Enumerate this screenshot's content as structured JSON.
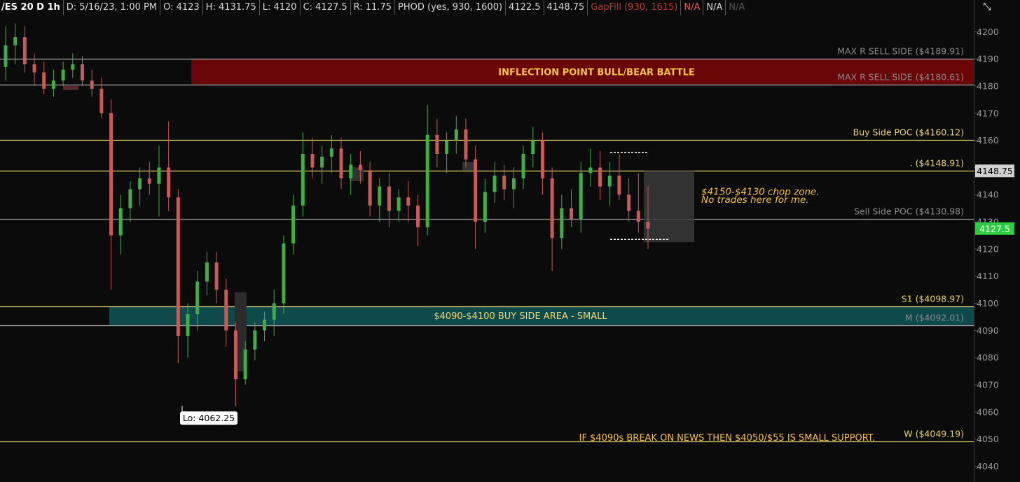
{
  "header": {
    "symbol": "/ES 20 D 1h",
    "date": "D: 5/16/23, 1:00 PM",
    "open": "O: 4123",
    "high": "H: 4131.75",
    "low": "L: 4120",
    "close": "C: 4127.5",
    "range": "R: 11.75",
    "phod": "PHOD (yes, 930, 1600)",
    "val1": "4122.5",
    "val2": "4148.75",
    "gapfill": "GapFill (930, 1615)",
    "na1": "N/A",
    "na2": "N/A",
    "na3": "N/A"
  },
  "chart_data": {
    "type": "candlestick",
    "ylim": [
      4036,
      4206
    ],
    "y_ticks": [
      4040,
      4050,
      4060,
      4070,
      4080,
      4090,
      4100,
      4110,
      4120,
      4130,
      4140,
      4150,
      4160,
      4170,
      4180,
      4190,
      4200
    ],
    "price_tags": [
      {
        "label": "4148.75",
        "value": 4148.75,
        "color": "#d0d0d0",
        "text_color": "#000000"
      },
      {
        "label": "4127.5",
        "value": 4127.5,
        "color": "#2ecc40",
        "text_color": "#ffffff"
      }
    ],
    "levels": [
      {
        "label": "MAX R SELL SIDE  ($4189.91)",
        "value": 4189.91,
        "color": "#aaaaaa",
        "text_color": "#8a8a8a"
      },
      {
        "label": "MAX R SELL SIDE  ($4180.61)",
        "value": 4180.61,
        "color": "#aaaaaa",
        "text_color": "#8a8a8a"
      },
      {
        "label": "Buy Side POC  ($4160.12)",
        "value": 4160.12,
        "color": "#e8d36a",
        "text_color": "#e8d36a"
      },
      {
        "label": ". ($4148.91)",
        "value": 4148.91,
        "color": "#e8d36a",
        "text_color": "#e8d36a"
      },
      {
        "label": "Sell Side POC ($4130.98)",
        "value": 4130.98,
        "color": "#8a8a8a",
        "text_color": "#8a8a8a"
      },
      {
        "label": "S1 ($4098.97)",
        "value": 4098.97,
        "color": "#e8d36a",
        "text_color": "#e8d36a"
      },
      {
        "label": "M ($4092.01)",
        "value": 4092.01,
        "color": "#aaaaaa",
        "text_color": "#8a8a8a"
      },
      {
        "label": "W ($4049.19)",
        "value": 4049.19,
        "color": "#e8d36a",
        "text_color": "#e8d36a"
      }
    ],
    "zones": [
      {
        "label": "INFLECTION POINT BULL/BEAR BATTLE",
        "from": 4180.61,
        "to": 4189.91,
        "color": "#6a0606",
        "text_color": "#f5c242"
      },
      {
        "label": "$4090-$4100 BUY SIDE AREA - SMALL",
        "from": 4092.01,
        "to": 4098.97,
        "color": "#0e4a4c",
        "text_color": "#f5d76e"
      }
    ],
    "annotations": [
      {
        "text": "$4150-$4130 chop zone.",
        "value": 4141
      },
      {
        "text": "No trades here for me.",
        "value": 4138
      },
      {
        "text": "IF $4090s BREAK ON NEWS THEN $4050/$55 IS SMALL SUPPORT.",
        "value": 4051
      }
    ],
    "low_label": {
      "text": "Lo: 4062.25",
      "value": 4062.25
    },
    "candles": [
      [
        4187,
        4202,
        4182,
        4195
      ],
      [
        4195,
        4203,
        4188,
        4198
      ],
      [
        4198,
        4202,
        4185,
        4188
      ],
      [
        4188,
        4192,
        4180,
        4185
      ],
      [
        4185,
        4189,
        4177,
        4179
      ],
      [
        4179,
        4186,
        4176,
        4182
      ],
      [
        4182,
        4189,
        4180,
        4186
      ],
      [
        4186,
        4192,
        4183,
        4188
      ],
      [
        4188,
        4191,
        4180,
        4182
      ],
      [
        4182,
        4186,
        4176,
        4179
      ],
      [
        4179,
        4183,
        4168,
        4170
      ],
      [
        4170,
        4175,
        4105,
        4125
      ],
      [
        4125,
        4140,
        4118,
        4135
      ],
      [
        4135,
        4145,
        4130,
        4142
      ],
      [
        4142,
        4150,
        4136,
        4146
      ],
      [
        4146,
        4152,
        4140,
        4144
      ],
      [
        4144,
        4158,
        4132,
        4150
      ],
      [
        4150,
        4167,
        4134,
        4139
      ],
      [
        4139,
        4142,
        4078,
        4088
      ],
      [
        4088,
        4100,
        4080,
        4096
      ],
      [
        4096,
        4112,
        4090,
        4108
      ],
      [
        4108,
        4119,
        4103,
        4115
      ],
      [
        4115,
        4119,
        4100,
        4105
      ],
      [
        4105,
        4109,
        4084,
        4090
      ],
      [
        4090,
        4093,
        4062,
        4072
      ],
      [
        4072,
        4086,
        4070,
        4083
      ],
      [
        4083,
        4093,
        4079,
        4090
      ],
      [
        4090,
        4097,
        4086,
        4094
      ],
      [
        4094,
        4105,
        4088,
        4100
      ],
      [
        4100,
        4125,
        4096,
        4122
      ],
      [
        4122,
        4140,
        4118,
        4136
      ],
      [
        4136,
        4163,
        4132,
        4155
      ],
      [
        4155,
        4161,
        4146,
        4150
      ],
      [
        4150,
        4158,
        4144,
        4154
      ],
      [
        4154,
        4162,
        4148,
        4157
      ],
      [
        4157,
        4161,
        4142,
        4146
      ],
      [
        4146,
        4155,
        4140,
        4151
      ],
      [
        4151,
        4156,
        4144,
        4149
      ],
      [
        4149,
        4152,
        4132,
        4136
      ],
      [
        4136,
        4146,
        4130,
        4143
      ],
      [
        4143,
        4148,
        4128,
        4134
      ],
      [
        4134,
        4142,
        4130,
        4139
      ],
      [
        4139,
        4145,
        4130,
        4136
      ],
      [
        4136,
        4140,
        4121,
        4128
      ],
      [
        4128,
        4173,
        4125,
        4162
      ],
      [
        4162,
        4168,
        4150,
        4155
      ],
      [
        4155,
        4163,
        4148,
        4160
      ],
      [
        4160,
        4169,
        4155,
        4164
      ],
      [
        4164,
        4168,
        4150,
        4153
      ],
      [
        4153,
        4158,
        4120,
        4130
      ],
      [
        4130,
        4146,
        4126,
        4141
      ],
      [
        4141,
        4152,
        4137,
        4147
      ],
      [
        4147,
        4151,
        4138,
        4142
      ],
      [
        4142,
        4150,
        4135,
        4146
      ],
      [
        4146,
        4158,
        4142,
        4155
      ],
      [
        4155,
        4165,
        4150,
        4160
      ],
      [
        4160,
        4163,
        4140,
        4146
      ],
      [
        4146,
        4150,
        4112,
        4124
      ],
      [
        4124,
        4140,
        4120,
        4135
      ],
      [
        4135,
        4142,
        4128,
        4131
      ],
      [
        4131,
        4152,
        4126,
        4148
      ],
      [
        4148,
        4157,
        4143,
        4150
      ],
      [
        4150,
        4156,
        4138,
        4143
      ],
      [
        4143,
        4152,
        4136,
        4147
      ],
      [
        4147,
        4155,
        4138,
        4140
      ],
      [
        4140,
        4146,
        4130,
        4134
      ],
      [
        4134,
        4148,
        4126,
        4130
      ],
      [
        4130,
        4143,
        4120,
        4127.5
      ]
    ]
  }
}
